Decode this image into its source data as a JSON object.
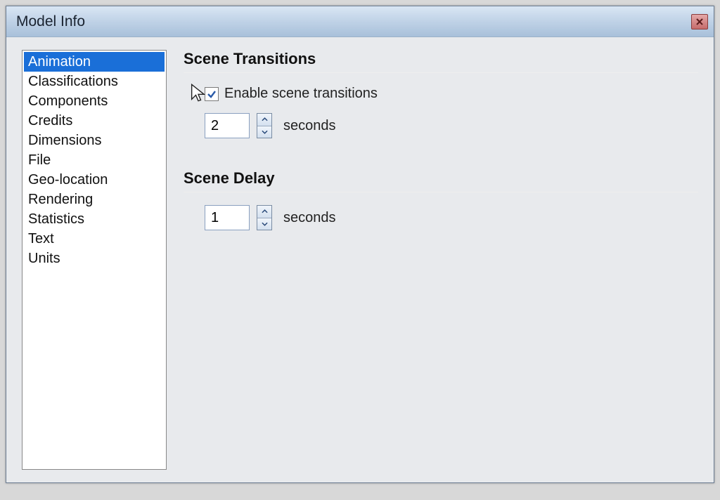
{
  "window": {
    "title": "Model Info"
  },
  "sidebar": {
    "items": [
      "Animation",
      "Classifications",
      "Components",
      "Credits",
      "Dimensions",
      "File",
      "Geo-location",
      "Rendering",
      "Statistics",
      "Text",
      "Units"
    ],
    "selectedIndex": 0
  },
  "section1": {
    "heading": "Scene Transitions",
    "checkbox_label": "Enable scene transitions",
    "checkbox_checked": true,
    "value": "2",
    "unit": "seconds"
  },
  "section2": {
    "heading": "Scene Delay",
    "value": "1",
    "unit": "seconds"
  },
  "colors": {
    "selection": "#1a6fd8",
    "titlebar_top": "#d9e6f4"
  }
}
